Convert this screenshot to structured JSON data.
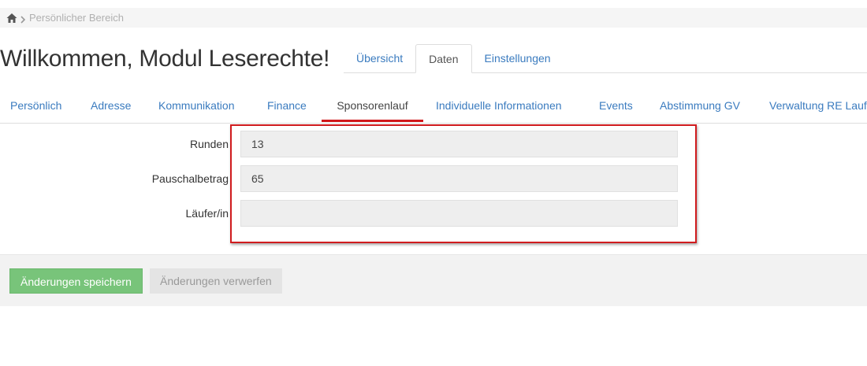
{
  "breadcrumb": {
    "home_icon": "home-icon",
    "separator_icon": "chevron-right-icon",
    "current": "Persönlicher Bereich"
  },
  "page": {
    "title": "Willkommen, Modul Leserechte!"
  },
  "top_tabs": [
    {
      "label": "Übersicht",
      "active": false
    },
    {
      "label": "Daten",
      "active": true
    },
    {
      "label": "Einstellungen",
      "active": false
    }
  ],
  "sub_tabs": [
    {
      "label": "Persönlich",
      "active": false
    },
    {
      "label": "Adresse",
      "active": false
    },
    {
      "label": "Kommunikation",
      "active": false
    },
    {
      "label": "Finance",
      "active": false
    },
    {
      "label": "Sponsorenlauf",
      "active": true
    },
    {
      "label": "Individuelle Informationen",
      "active": false
    },
    {
      "label": "Events",
      "active": false
    },
    {
      "label": "Abstimmung GV",
      "active": false
    },
    {
      "label": "Verwaltung RE Lauf",
      "active": false
    }
  ],
  "form": {
    "fields": [
      {
        "label": "Runden",
        "value": "13"
      },
      {
        "label": "Pauschalbetrag",
        "value": "65"
      },
      {
        "label": "Läufer/in",
        "value": ""
      }
    ]
  },
  "actions": {
    "save_label": "Änderungen speichern",
    "discard_label": "Änderungen verwerfen"
  },
  "colors": {
    "link": "#3a7bbf",
    "active_tab_underline": "#d0181b",
    "highlight_border": "#d01b1e",
    "save_button": "#78c47a",
    "discard_button": "#e4e4e4"
  }
}
